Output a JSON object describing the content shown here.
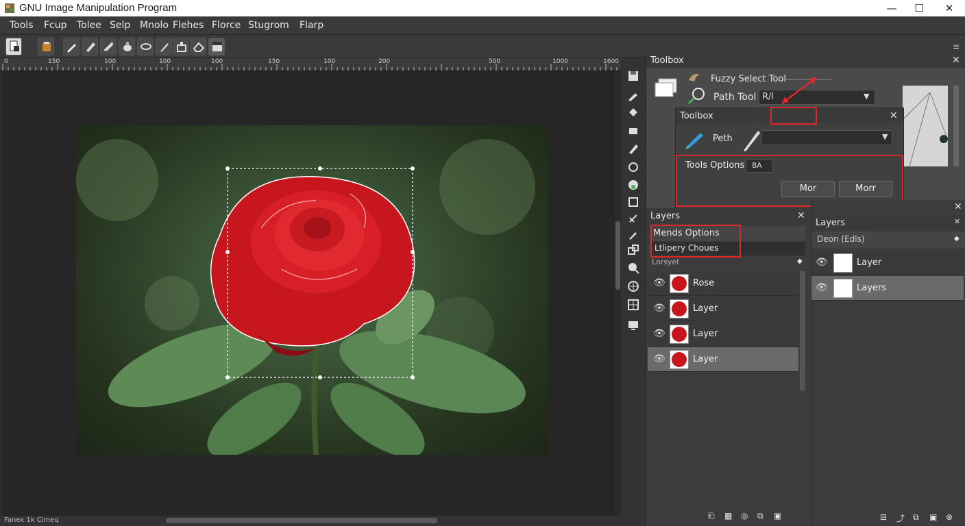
{
  "window": {
    "title": "GNU Image Manipulation Program",
    "minimize": "—",
    "maximize": "☐",
    "close": "✕"
  },
  "menu": [
    "Tools",
    "Fcup",
    "Tolee",
    "Selp",
    "Mnolo",
    "Flehes",
    "Florce",
    "Stugrom",
    "Flarp"
  ],
  "ruler": [
    "0",
    "150",
    "100",
    "100",
    "100",
    "150",
    "100",
    "200",
    "500",
    "1000",
    "1600"
  ],
  "status": {
    "text": "Fanex 1k Cimeq"
  },
  "toolbox_panel": {
    "title": "Toolbox",
    "fuzzy_select_label": "Fuzzy Select Tool",
    "path_tool_label": "Path Tool",
    "path_tool_value": "R/l"
  },
  "toolbox_popup": {
    "title": "Toolbox",
    "path_label": "Peth",
    "path_value": "",
    "tools_options_label": "Tools Options",
    "tools_options_value": "8A",
    "btn_left": "Mor",
    "btn_right": "Morr"
  },
  "layers_panel_left": {
    "title": "Layers",
    "options_title": "Mends Options",
    "options_value": "Ltlipery Choues",
    "section_label": "Lorsyel",
    "rows": [
      {
        "label": "Rose",
        "selected": false
      },
      {
        "label": "Layer",
        "selected": false
      },
      {
        "label": "Layer",
        "selected": false
      },
      {
        "label": "Layer",
        "selected": true
      }
    ]
  },
  "layers_panel_right": {
    "title": "Layers",
    "mode_label": "Deon (Edls)",
    "rows": [
      {
        "label": "Layer",
        "selected": false
      },
      {
        "label": "Layers",
        "selected": true
      }
    ]
  },
  "colors": {
    "accent_red": "#e0282b",
    "rose": "#d01c22",
    "panel": "#3c3c3c"
  }
}
